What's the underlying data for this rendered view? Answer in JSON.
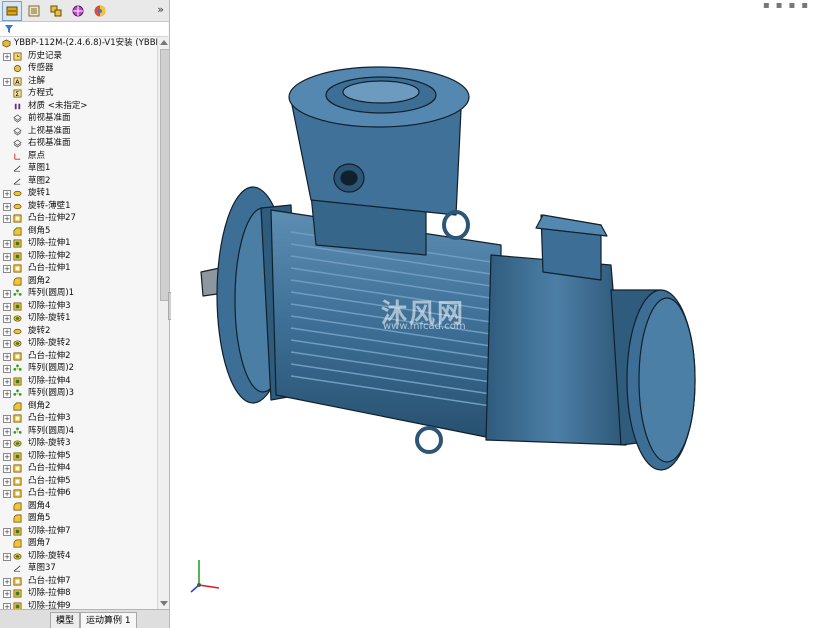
{
  "toolbar": {
    "icons": [
      "feature-manager-icon",
      "property-manager-icon",
      "configuration-manager-icon",
      "dimxpert-icon",
      "display-manager-icon"
    ],
    "more": "»"
  },
  "tree": {
    "root": "YBBP-112M-(2.4.6.8)-V1安装  (YBBP",
    "items": [
      {
        "label": "历史记录",
        "icon": "history-icon",
        "exp": true
      },
      {
        "label": "传感器",
        "icon": "sensor-icon",
        "exp": false
      },
      {
        "label": "注解",
        "icon": "annotation-icon",
        "exp": true
      },
      {
        "label": "方程式",
        "icon": "equation-icon",
        "exp": false
      },
      {
        "label": "材质 <未指定>",
        "icon": "material-icon",
        "exp": false
      },
      {
        "label": "前视基准面",
        "icon": "plane-icon",
        "exp": false
      },
      {
        "label": "上视基准面",
        "icon": "plane-icon",
        "exp": false
      },
      {
        "label": "右视基准面",
        "icon": "plane-icon",
        "exp": false
      },
      {
        "label": "原点",
        "icon": "origin-icon",
        "exp": false
      },
      {
        "label": "草图1",
        "icon": "sketch-icon",
        "exp": false
      },
      {
        "label": "草图2",
        "icon": "sketch-icon",
        "exp": false
      },
      {
        "label": "旋转1",
        "icon": "revolve-icon",
        "exp": true
      },
      {
        "label": "旋转-薄壁1",
        "icon": "revolve-icon",
        "exp": true
      },
      {
        "label": "凸台-拉伸27",
        "icon": "extrude-icon",
        "exp": true
      },
      {
        "label": "倒角5",
        "icon": "chamfer-icon",
        "exp": false
      },
      {
        "label": "切除-拉伸1",
        "icon": "cut-extrude-icon",
        "exp": true
      },
      {
        "label": "切除-拉伸2",
        "icon": "cut-extrude-icon",
        "exp": true
      },
      {
        "label": "凸台-拉伸1",
        "icon": "extrude-icon",
        "exp": true
      },
      {
        "label": "圆角2",
        "icon": "fillet-icon",
        "exp": false
      },
      {
        "label": "阵列(圆周)1",
        "icon": "pattern-icon",
        "exp": true
      },
      {
        "label": "切除-拉伸3",
        "icon": "cut-extrude-icon",
        "exp": true
      },
      {
        "label": "切除-旋转1",
        "icon": "cut-revolve-icon",
        "exp": true
      },
      {
        "label": "旋转2",
        "icon": "revolve-icon",
        "exp": true
      },
      {
        "label": "切除-旋转2",
        "icon": "cut-revolve-icon",
        "exp": true
      },
      {
        "label": "凸台-拉伸2",
        "icon": "extrude-icon",
        "exp": true
      },
      {
        "label": "阵列(圆周)2",
        "icon": "pattern-icon",
        "exp": true
      },
      {
        "label": "切除-拉伸4",
        "icon": "cut-extrude-icon",
        "exp": true
      },
      {
        "label": "阵列(圆周)3",
        "icon": "pattern-icon",
        "exp": true
      },
      {
        "label": "倒角2",
        "icon": "chamfer-icon",
        "exp": false
      },
      {
        "label": "凸台-拉伸3",
        "icon": "extrude-icon",
        "exp": true
      },
      {
        "label": "阵列(圆周)4",
        "icon": "pattern-icon",
        "exp": true
      },
      {
        "label": "切除-旋转3",
        "icon": "cut-revolve-icon",
        "exp": true
      },
      {
        "label": "切除-拉伸5",
        "icon": "cut-extrude-icon",
        "exp": true
      },
      {
        "label": "凸台-拉伸4",
        "icon": "extrude-icon",
        "exp": true
      },
      {
        "label": "凸台-拉伸5",
        "icon": "extrude-icon",
        "exp": true
      },
      {
        "label": "凸台-拉伸6",
        "icon": "extrude-icon",
        "exp": true
      },
      {
        "label": "圆角4",
        "icon": "fillet-icon",
        "exp": false
      },
      {
        "label": "圆角5",
        "icon": "fillet-icon",
        "exp": false
      },
      {
        "label": "切除-拉伸7",
        "icon": "cut-extrude-icon",
        "exp": true
      },
      {
        "label": "圆角7",
        "icon": "fillet-icon",
        "exp": false
      },
      {
        "label": "切除-旋转4",
        "icon": "cut-revolve-icon",
        "exp": true
      },
      {
        "label": "草图37",
        "icon": "sketch-icon",
        "exp": false
      },
      {
        "label": "凸台-拉伸7",
        "icon": "extrude-icon",
        "exp": true
      },
      {
        "label": "切除-拉伸8",
        "icon": "cut-extrude-icon",
        "exp": true
      },
      {
        "label": "切除-拉伸9",
        "icon": "cut-extrude-icon",
        "exp": true
      }
    ]
  },
  "bottom_tabs": [
    "模型",
    "运动算例 1"
  ],
  "watermark": {
    "text": "沐风网",
    "url": "www.mfcad.com"
  },
  "colors": {
    "model": "#3d6f96",
    "model_dark": "#24465f",
    "model_light": "#6d9bbf",
    "edge": "#10202c",
    "axis_x": "#d62020",
    "axis_y": "#1c9c1c",
    "axis_z": "#2a3fd0"
  }
}
